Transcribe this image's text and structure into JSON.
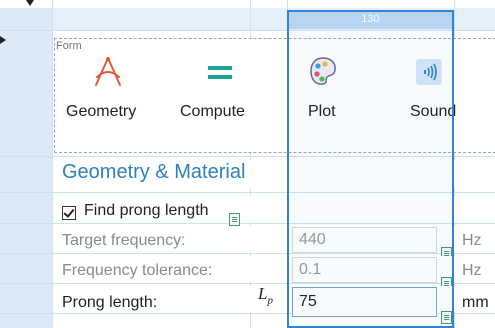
{
  "toolbar": {
    "form_label": "Form",
    "items": [
      {
        "label": "Geometry",
        "icon": "compass-icon"
      },
      {
        "label": "Compute",
        "icon": "equals-icon"
      },
      {
        "label": "Plot",
        "icon": "palette-icon"
      },
      {
        "label": "Sound",
        "icon": "sound-wave-icon"
      }
    ]
  },
  "grid": {
    "selected_column_number": "130"
  },
  "section": {
    "title": "Geometry & Material"
  },
  "find_prong": {
    "label": "Find prong length",
    "checked": true
  },
  "fields": [
    {
      "label": "Target frequency:",
      "value": "440",
      "unit": "Hz",
      "enabled": false
    },
    {
      "label": "Frequency tolerance:",
      "value": "0.1",
      "unit": "Hz",
      "enabled": false
    },
    {
      "label": "Prong length:",
      "symbol": "L",
      "symbol_sub": "p",
      "value": "75",
      "unit": "mm",
      "enabled": true
    }
  ],
  "colors": {
    "accent": "#2f84d6",
    "section_title": "#2f80c1",
    "grid_line": "#cfe0f2",
    "compass": "#e05a3a",
    "equals": "#1aa39a"
  }
}
